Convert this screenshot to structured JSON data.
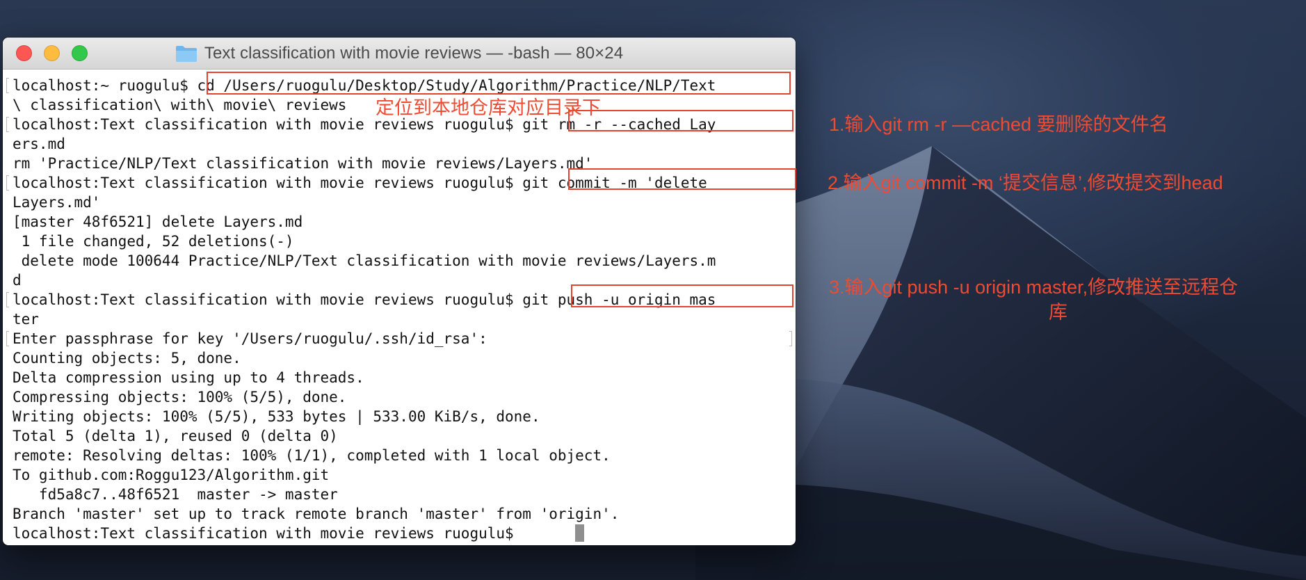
{
  "window": {
    "title": "Text classification with movie reviews — -bash — 80×24"
  },
  "terminal_lines": [
    "localhost:~ ruogulu$ cd /Users/ruogulu/Desktop/Study/Algorithm/Practice/NLP/Text",
    "\\ classification\\ with\\ movie\\ reviews",
    "localhost:Text classification with movie reviews ruogulu$ git rm -r --cached Lay",
    "ers.md",
    "rm 'Practice/NLP/Text classification with movie reviews/Layers.md'",
    "localhost:Text classification with movie reviews ruogulu$ git commit -m 'delete ",
    "Layers.md'",
    "[master 48f6521] delete Layers.md",
    " 1 file changed, 52 deletions(-)",
    " delete mode 100644 Practice/NLP/Text classification with movie reviews/Layers.m",
    "d",
    "localhost:Text classification with movie reviews ruogulu$ git push -u origin mas",
    "ter",
    "Enter passphrase for key '/Users/ruogulu/.ssh/id_rsa':",
    "Counting objects: 5, done.",
    "Delta compression using up to 4 threads.",
    "Compressing objects: 100% (5/5), done.",
    "Writing objects: 100% (5/5), 533 bytes | 533.00 KiB/s, done.",
    "Total 5 (delta 1), reused 0 (delta 0)",
    "remote: Resolving deltas: 100% (1/1), completed with 1 local object.",
    "To github.com:Roggu123/Algorithm.git",
    "   fd5a8c7..48f6521  master -> master",
    "Branch 'master' set up to track remote branch 'master' from 'origin'.",
    "localhost:Text classification with movie reviews ruogulu$ "
  ],
  "annotations": {
    "step0": "定位到本地仓库对应目录下",
    "step1": "1.输入git rm -r —cached 要删除的文件名",
    "step2": "2.输入git commit -m ‘提交信息’,修改提交到head",
    "step3_line1": "3.输入git push -u origin master,修改推送至远程仓",
    "step3_line2": "库"
  },
  "colors": {
    "annotation_red": "#ef4a32",
    "close": "#fc5753",
    "minimize": "#fdbc40",
    "maximize": "#34c84a"
  },
  "icons": [
    "folder-icon"
  ]
}
